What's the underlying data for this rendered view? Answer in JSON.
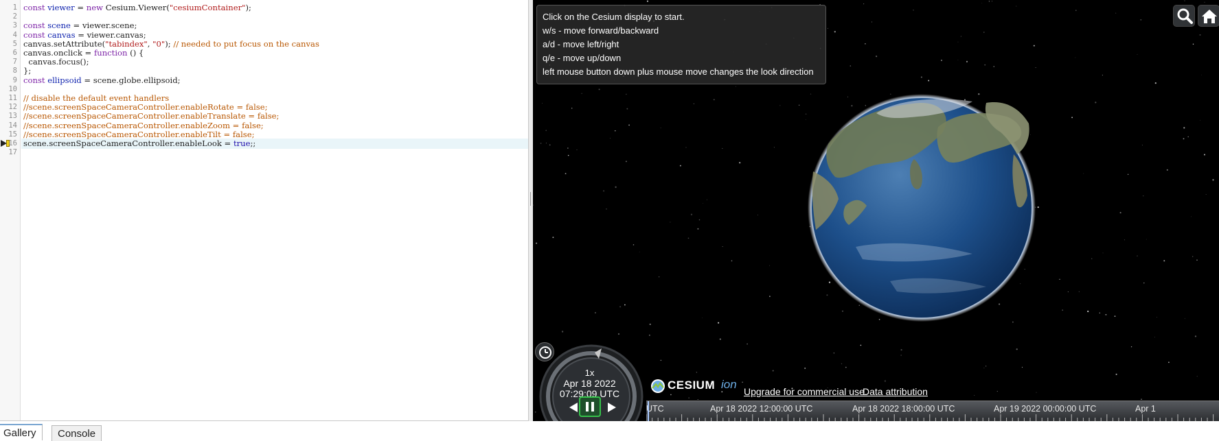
{
  "editor": {
    "line_numbers": [
      "1",
      "2",
      "3",
      "4",
      "5",
      "6",
      "7",
      "8",
      "9",
      "10",
      "11",
      "12",
      "13",
      "14",
      "15",
      "16",
      "17"
    ],
    "lines": [
      [
        {
          "t": "kw",
          "v": "const "
        },
        {
          "t": "var",
          "v": "viewer"
        },
        {
          "t": "txt",
          "v": " = "
        },
        {
          "t": "kw",
          "v": "new "
        },
        {
          "t": "txt",
          "v": "Cesium.Viewer("
        },
        {
          "t": "str",
          "v": "\"cesiumContainer\""
        },
        {
          "t": "txt",
          "v": ");"
        }
      ],
      [],
      [
        {
          "t": "kw",
          "v": "const "
        },
        {
          "t": "var",
          "v": "scene"
        },
        {
          "t": "txt",
          "v": " = viewer.scene;"
        }
      ],
      [
        {
          "t": "kw",
          "v": "const "
        },
        {
          "t": "var",
          "v": "canvas"
        },
        {
          "t": "txt",
          "v": " = viewer.canvas;"
        }
      ],
      [
        {
          "t": "txt",
          "v": "canvas.setAttribute("
        },
        {
          "t": "str",
          "v": "\"tabindex\""
        },
        {
          "t": "txt",
          "v": ", "
        },
        {
          "t": "str",
          "v": "\"0\""
        },
        {
          "t": "txt",
          "v": "); "
        },
        {
          "t": "cm",
          "v": "// needed to put focus on the canvas"
        }
      ],
      [
        {
          "t": "txt",
          "v": "canvas.onclick = "
        },
        {
          "t": "kw",
          "v": "function"
        },
        {
          "t": "txt",
          "v": " () {"
        }
      ],
      [
        {
          "t": "txt",
          "v": "  canvas.focus();"
        }
      ],
      [
        {
          "t": "txt",
          "v": "};"
        }
      ],
      [
        {
          "t": "kw",
          "v": "const "
        },
        {
          "t": "var",
          "v": "ellipsoid"
        },
        {
          "t": "txt",
          "v": " = scene.globe.ellipsoid;"
        }
      ],
      [],
      [
        {
          "t": "cm",
          "v": "// disable the default event handlers"
        }
      ],
      [
        {
          "t": "cm",
          "v": "//scene.screenSpaceCameraController.enableRotate = false;"
        }
      ],
      [
        {
          "t": "cm",
          "v": "//scene.screenSpaceCameraController.enableTranslate = false;"
        }
      ],
      [
        {
          "t": "cm",
          "v": "//scene.screenSpaceCameraController.enableZoom = false;"
        }
      ],
      [
        {
          "t": "cm",
          "v": "//scene.screenSpaceCameraController.enableTilt = false;"
        }
      ],
      [
        {
          "t": "txt",
          "v": "scene.screenSpaceCameraController.enableLook = "
        },
        {
          "t": "bool",
          "v": "true"
        },
        {
          "t": "txt",
          "v": ";;"
        }
      ],
      []
    ]
  },
  "viewer": {
    "instructions": [
      "Click on the Cesium display to start.",
      "w/s - move forward/backward",
      "a/d - move left/right",
      "q/e - move up/down",
      "left mouse button down plus mouse move changes the look direction"
    ],
    "toolbar": {
      "search_icon": "search-icon",
      "home_icon": "home-icon"
    },
    "animation": {
      "speed": "1x",
      "date": "Apr 18 2022",
      "time": "07:29:09 UTC"
    },
    "credits": {
      "logo_text": "CESIUM",
      "logo_suffix": "ion",
      "upgrade": "Upgrade for commercial use.",
      "attribution": "Data attribution"
    },
    "timeline": {
      "labels": [
        "UTC",
        "Apr 18 2022 12:00:00 UTC",
        "Apr 18 2022 18:00:00 UTC",
        "Apr 19 2022 00:00:00 UTC",
        "Apr 1"
      ]
    }
  },
  "tabs": {
    "gallery": "Gallery",
    "console": "Console"
  },
  "colors": {
    "keyword": "#7b20a6",
    "variable": "#0b1fad",
    "string": "#b01b1b",
    "comment": "#b85600",
    "pause_highlight": "#35c24a",
    "globe_ocean": "#1d4f8a"
  }
}
